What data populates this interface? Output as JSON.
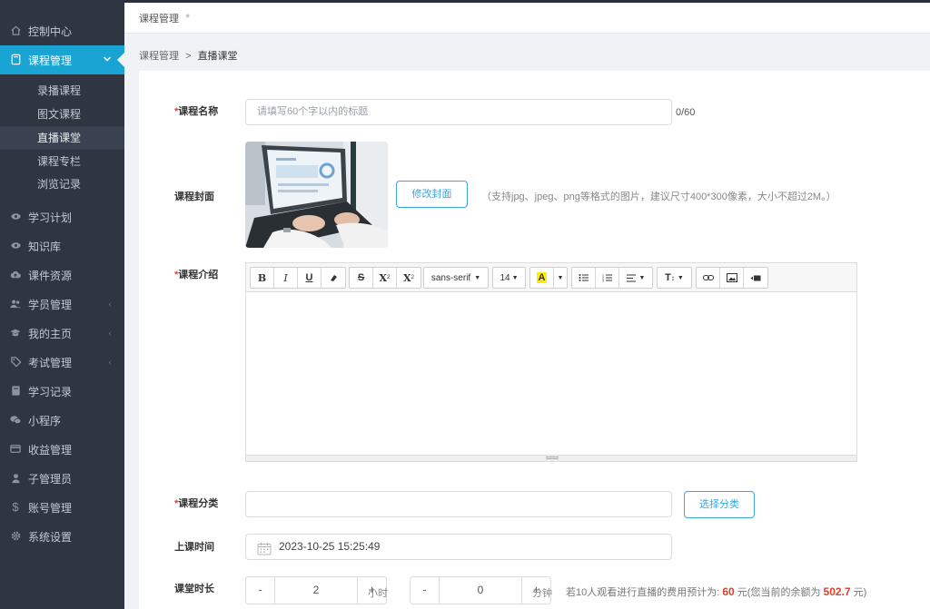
{
  "sidebar": {
    "items": [
      {
        "label": "控制中心",
        "icon": "home-icon"
      },
      {
        "label": "课程管理",
        "icon": "book-icon",
        "active": true
      },
      {
        "label": "学习计划",
        "icon": "eye-icon"
      },
      {
        "label": "知识库",
        "icon": "eye-icon"
      },
      {
        "label": "课件资源",
        "icon": "cloud-upload-icon"
      },
      {
        "label": "学员管理",
        "icon": "users-icon"
      },
      {
        "label": "我的主页",
        "icon": "graduation-cap-icon"
      },
      {
        "label": "考试管理",
        "icon": "tag-icon"
      },
      {
        "label": "学习记录",
        "icon": "book-icon"
      },
      {
        "label": "小程序",
        "icon": "wechat-icon"
      },
      {
        "label": "收益管理",
        "icon": "credit-card-icon"
      },
      {
        "label": "子管理员",
        "icon": "user-secret-icon"
      },
      {
        "label": "账号管理",
        "icon": "dollar-icon"
      },
      {
        "label": "系统设置",
        "icon": "gear-icon"
      }
    ],
    "sub_items": [
      {
        "label": "录播课程"
      },
      {
        "label": "图文课程"
      },
      {
        "label": "直播课堂",
        "current": true
      },
      {
        "label": "课程专栏"
      },
      {
        "label": "浏览记录"
      }
    ]
  },
  "tabstrip": {
    "tab_label": "课程管理"
  },
  "breadcrumb": {
    "parent": "课程管理",
    "separator": ">",
    "current": "直播课堂"
  },
  "form": {
    "title_label": "课程名称",
    "title_placeholder": "请填写60个字以内的标题",
    "title_counter": "0/60",
    "cover_label": "课程封面",
    "cover_button": "修改封面",
    "cover_hint": "（支持jpg、jpeg、png等格式的图片，建议尺寸400*300像素，大小不超过2M。）",
    "intro_label": "课程介绍",
    "editor": {
      "font_family": "sans-serif",
      "font_size": "14"
    },
    "category_label": "课程分类",
    "category_value": "",
    "category_button": "选择分类",
    "time_label": "上课时间",
    "time_value": "2023-10-25 15:25:49",
    "duration_label": "课堂时长",
    "hours_value": "2",
    "hours_unit": "小时",
    "minutes_value": "0",
    "minutes_unit": "分钟",
    "cost_prefix": "若10人观看进行直播的费用预计为:",
    "cost_amount": "60",
    "cost_mid": "元(您当前的余额为",
    "balance": "502.7",
    "cost_suffix": "元)"
  },
  "colors": {
    "sidebar_bg": "#2f3541",
    "accent": "#1aa4d3",
    "required": "#e5403d",
    "highlight": "#d9412b"
  }
}
